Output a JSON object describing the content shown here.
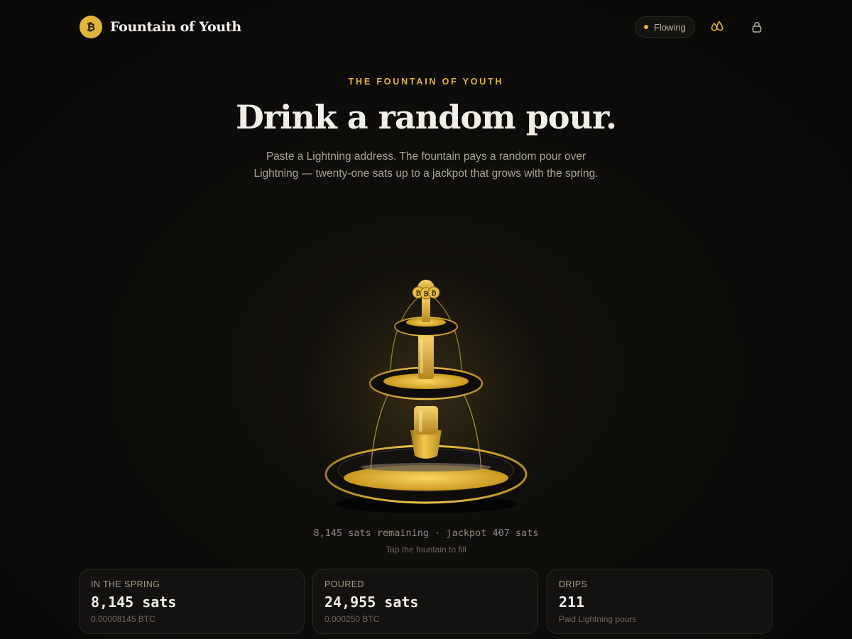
{
  "header": {
    "brand_name": "Fountain of Youth",
    "brand_logo_glyph": "₿",
    "status_label": "Flowing",
    "icons": [
      "droplets-icon",
      "lock-icon"
    ]
  },
  "hero": {
    "eyebrow": "THE FOUNTAIN OF YOUTH",
    "headline": "Drink a random pour.",
    "subtitle_line1": "Paste a Lightning address. The fountain pays a random pour over",
    "subtitle_line2": "Lightning — twenty-one sats up to a jackpot that grows with the spring."
  },
  "fountain": {
    "coin_glyph": "₿",
    "remaining_text": "8,145 sats remaining · jackpot 407 sats",
    "hint": "Tap the fountain to fill"
  },
  "stats": [
    {
      "label": "IN THE SPRING",
      "value": "8,145 sats",
      "sub": "0.00008145 BTC"
    },
    {
      "label": "POURED",
      "value": "24,955 sats",
      "sub": "0.000250 BTC"
    },
    {
      "label": "DRIPS",
      "value": "211",
      "sub": "Paid Lightning pours"
    }
  ],
  "colors": {
    "accent": "#e2b43b",
    "background": "#0d0c0a",
    "text": "#f3efe6",
    "muted": "#a9a291"
  }
}
